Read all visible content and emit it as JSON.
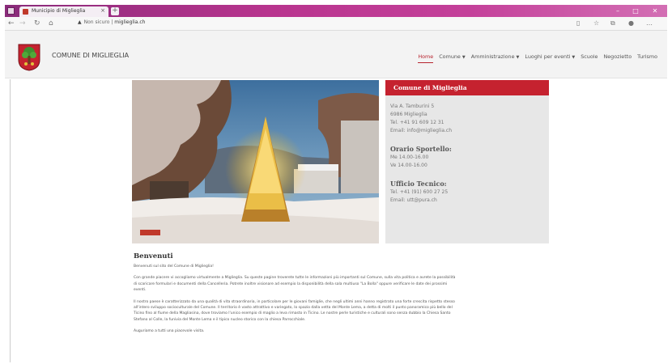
{
  "browser": {
    "tab_title": "Municipio di Miglieglia",
    "tab_close": "×",
    "new_tab": "+",
    "url_warning": "Non sicuro",
    "url_host": "miglieglia.ch"
  },
  "site": {
    "title": "COMUNE DI MIGLIEGLIA",
    "menu": [
      {
        "label": "Home",
        "active": true,
        "dropdown": false
      },
      {
        "label": "Comune",
        "active": false,
        "dropdown": true
      },
      {
        "label": "Amministrazione",
        "active": false,
        "dropdown": true
      },
      {
        "label": "Luoghi per eventi",
        "active": false,
        "dropdown": true
      },
      {
        "label": "Scuole",
        "active": false,
        "dropdown": false
      },
      {
        "label": "Negozietto",
        "active": false,
        "dropdown": false
      },
      {
        "label": "Turismo",
        "active": false,
        "dropdown": false
      }
    ]
  },
  "info": {
    "heading": "Comune di Miglieglia",
    "address_line1": "Via A. Tamburini 5",
    "address_line2": "6986 Miglieglia",
    "tel": "Tel. +41 91 609 12 31",
    "email": "Email: info@miglieglia.ch",
    "sportello_heading": "Orario Sportello:",
    "sportello_line1": "Me 14.00-16.00",
    "sportello_line2": "Ve 14.00-16.00",
    "tecnico_heading": "Ufficio Tecnico:",
    "tecnico_tel": "Tel. +41 (91) 600 27 25",
    "tecnico_email": "Email: utt@pura.ch"
  },
  "article": {
    "heading": "Benvenuti",
    "p1": "Benvenuti sul sito del Comune di Miglieglia!",
    "p2": "Con grande piacere vi accogliamo virtualmente a Miglieglia. Su queste pagine troverete tutte le informazioni più importanti sul Comune, sulla vita politica e avrete la possibilità di scaricare formulari e documenti della Cancelleria. Potrete inoltre visionare ad esempio la disponibilità della sala multiuso \"La Bolla\" oppure verificare le date dei prossimi eventi.",
    "p3": "Il nostro paese è caratterizzato da una qualità di vita straordinaria, in particolare per le giovani famiglie, che negli ultimi anni hanno registrato una forte crescita rispetto stesso all'intero sviluppo socioculturale del Comune. Il territorio è vasto attrattivo e variegato, lo spazio dalla vetta del Monte Lema, a detta di molti il punto panoramico più bello del Ticino fino al fiume della Magliasina, dove troviamo l'unico esempio di maglio a leva rimasto in Ticino. Le nostre perle turistiche e culturali sono senza dubbio la Chiesa Santo Stefano al Colle, la funivia del Monte Lema e il tipico nucleo storico con la chiesa Parrocchiale.",
    "p4": "Auguriamo a tutti una piacevole visita."
  },
  "colors": {
    "accent": "#c5222f",
    "titlebar": "#b8348e"
  },
  "icons": [
    "window-icon",
    "favicon",
    "back-icon",
    "forward-icon",
    "reload-icon",
    "home-icon",
    "warning-icon",
    "reading-view-icon",
    "favorites-icon",
    "collections-icon",
    "profile-icon",
    "more-icon",
    "coat-of-arms-logo"
  ]
}
